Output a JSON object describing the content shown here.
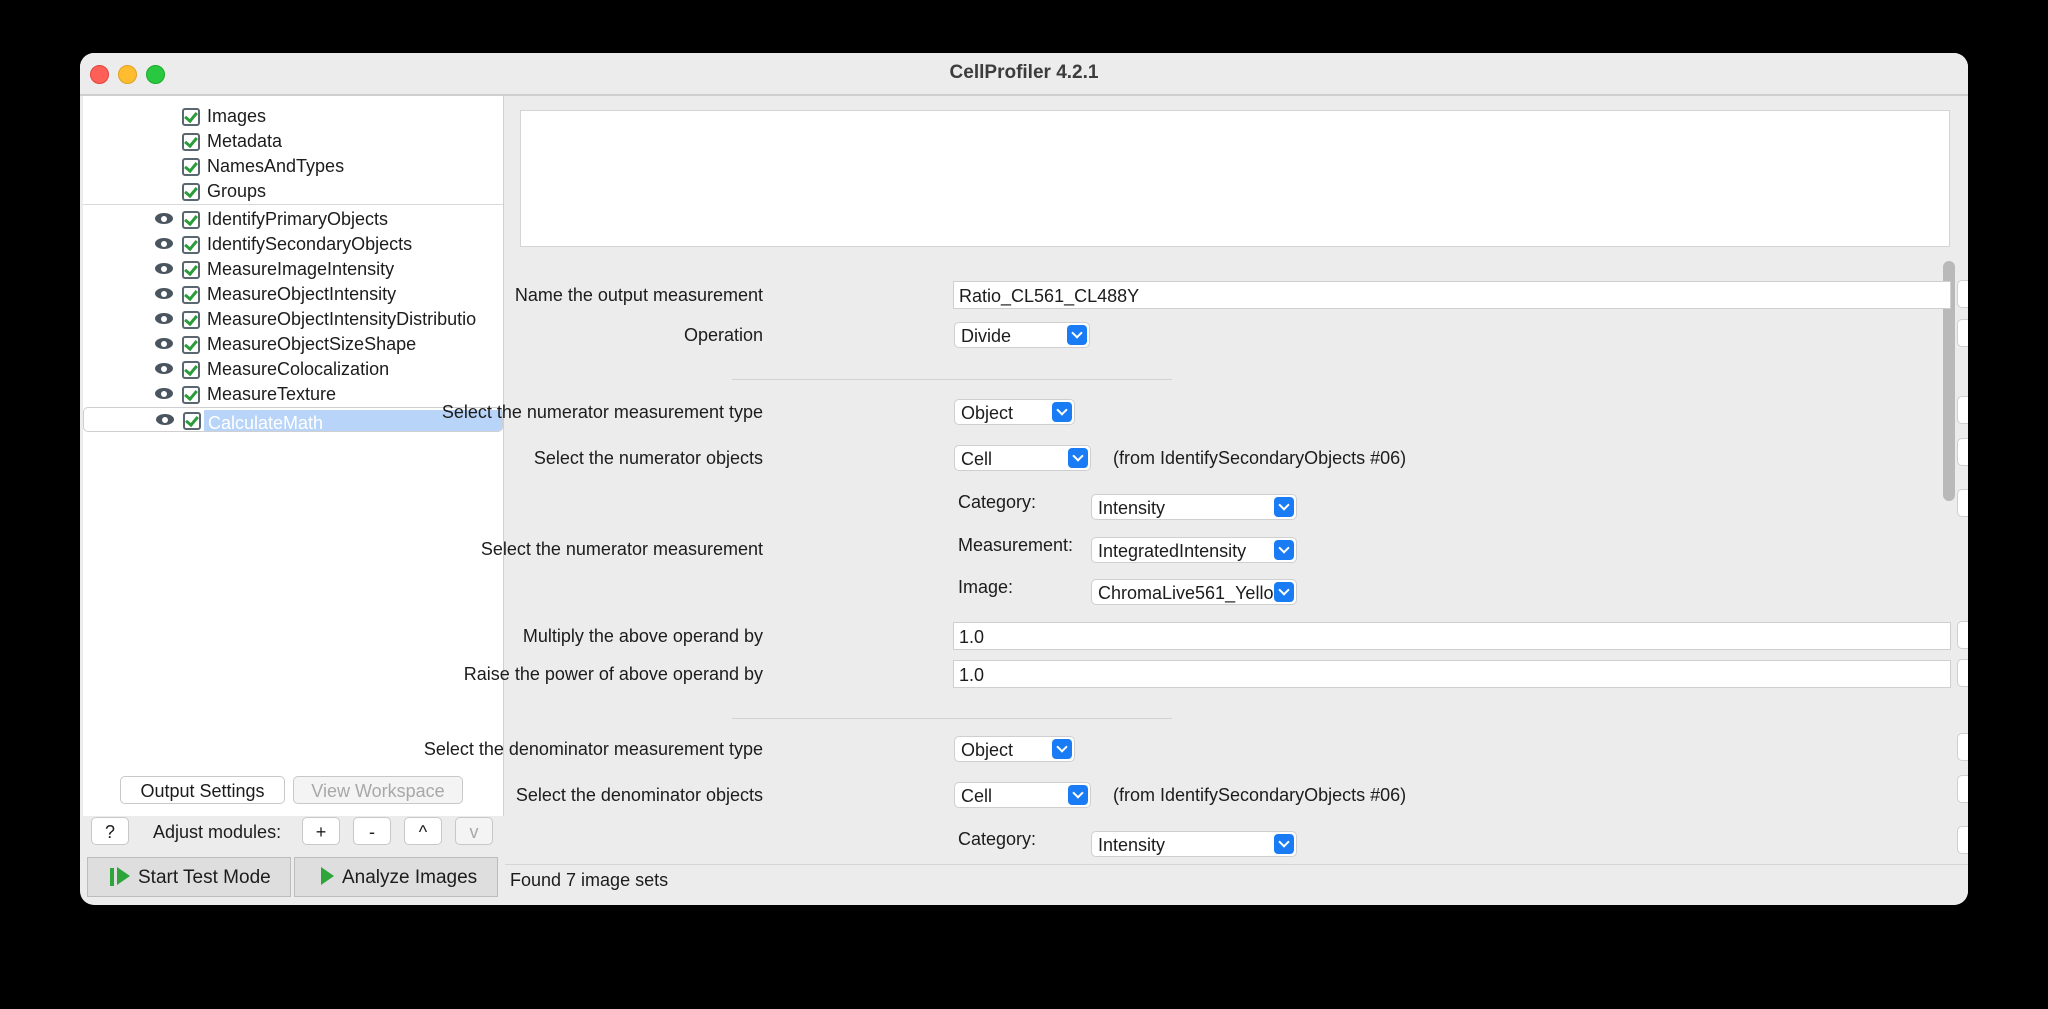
{
  "window": {
    "title": "CellProfiler 4.2.1"
  },
  "tree": {
    "input_modules": [
      "Images",
      "Metadata",
      "NamesAndTypes",
      "Groups"
    ],
    "analysis_modules": [
      "IdentifyPrimaryObjects",
      "IdentifySecondaryObjects",
      "MeasureImageIntensity",
      "MeasureObjectIntensity",
      "MeasureObjectIntensityDistributio",
      "MeasureObjectSizeShape",
      "MeasureColocalization",
      "MeasureTexture",
      "CalculateMath"
    ],
    "selected": "CalculateMath"
  },
  "left_buttons": {
    "output_settings": "Output Settings",
    "view_workspace": "View Workspace",
    "help": "?",
    "adjust_label": "Adjust modules:",
    "add": "+",
    "remove": "-",
    "up": "^",
    "down": "v",
    "start_test": "Start Test Mode",
    "analyze": "Analyze Images"
  },
  "settings": {
    "output_name_label": "Name the output measurement",
    "output_name_value": "Ratio_CL561_CL488Y",
    "operation_label": "Operation",
    "operation_value": "Divide",
    "num_type_label": "Select the numerator measurement type",
    "num_type_value": "Object",
    "num_objects_label": "Select the numerator objects",
    "num_objects_value": "Cell",
    "num_objects_note": "(from IdentifySecondaryObjects #06)",
    "category_label": "Category:",
    "num_category_value": "Intensity",
    "num_measurement_label": "Select the numerator measurement",
    "measurement_label": "Measurement:",
    "num_measurement_value": "IntegratedIntensity",
    "image_label": "Image:",
    "num_image_value": "ChromaLive561_Yello",
    "multiply_label": "Multiply the above operand by",
    "multiply_value": "1.0",
    "power_label": "Raise the power of above operand by",
    "power_value": "1.0",
    "den_type_label": "Select the denominator measurement type",
    "den_type_value": "Object",
    "den_objects_label": "Select the denominator objects",
    "den_objects_value": "Cell",
    "den_objects_note": "(from IdentifySecondaryObjects #06)",
    "den_category_value": "Intensity",
    "help": "?"
  },
  "status": "Found 7 image sets"
}
